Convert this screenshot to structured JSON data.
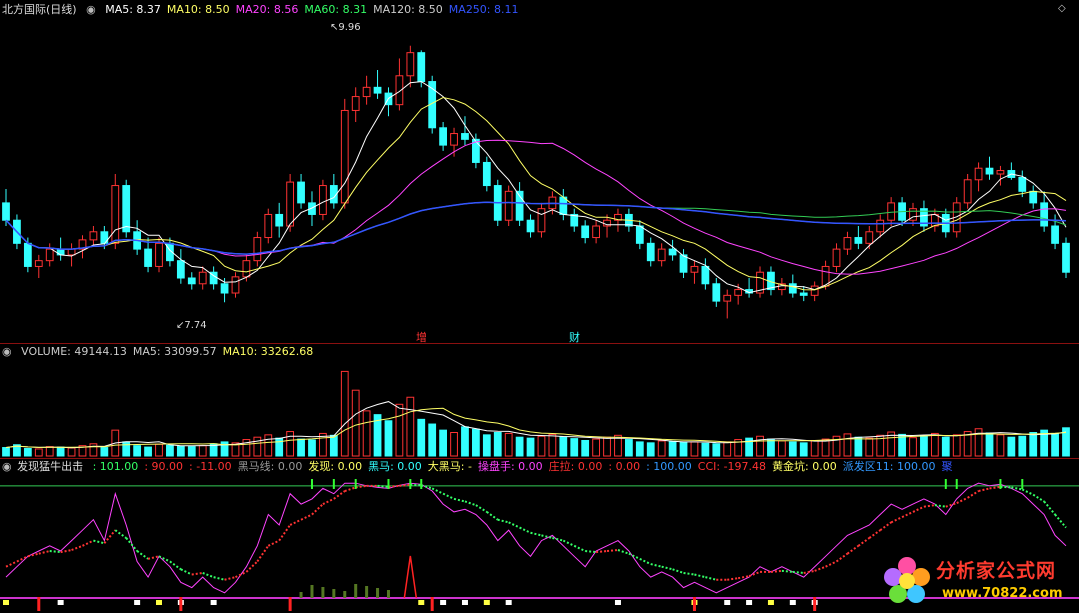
{
  "price_header": {
    "title": "北方国际(日线)",
    "items": [
      {
        "label": "MA5: 8.37",
        "color": "#ffffff"
      },
      {
        "label": "MA10: 8.50",
        "color": "#ffff66"
      },
      {
        "label": "MA20: 8.56",
        "color": "#ff44ff"
      },
      {
        "label": "MA60: 8.31",
        "color": "#33ff66"
      },
      {
        "label": "MA120: 8.50",
        "color": "#cccccc"
      },
      {
        "label": "MA250: 8.11",
        "color": "#3355ff"
      }
    ]
  },
  "volume_header": {
    "items": [
      {
        "label": "VOLUME: 49144.13",
        "color": "#cccccc"
      },
      {
        "label": "MA5: 33099.57",
        "color": "#cccccc"
      },
      {
        "label": "MA10: 33262.68",
        "color": "#ffff66"
      }
    ]
  },
  "indicator_header": {
    "title": "发现猛牛出击",
    "items": [
      {
        "label": ": 101.00",
        "color": "#33ff66"
      },
      {
        "label": ": 90.00",
        "color": "#ff3333"
      },
      {
        "label": ": -11.00",
        "color": "#ff3333"
      },
      {
        "label": "黑马线: 0.00",
        "color": "#999999"
      },
      {
        "label": "发现: 0.00",
        "color": "#ffff66"
      },
      {
        "label": "黑马: 0.00",
        "color": "#33ffff"
      },
      {
        "label": "大黑马: -",
        "color": "#ffff66"
      },
      {
        "label": "操盘手: 0.00",
        "color": "#ff44ff"
      },
      {
        "label": "庄拉: 0.00",
        "color": "#ff3333"
      },
      {
        "label": ": 0.00",
        "color": "#ff3333"
      },
      {
        "label": ": 100.00",
        "color": "#3399ff"
      },
      {
        "label": "CCI: -197.48",
        "color": "#ff3333"
      },
      {
        "label": "黄金坑: 0.00",
        "color": "#ffff66"
      },
      {
        "label": "派发区11: 100.00",
        "color": "#3399ff"
      },
      {
        "label": "聚",
        "color": "#3355ff"
      }
    ]
  },
  "icons": {
    "price_toggle": "circle-toggle-icon",
    "volume_toggle": "circle-toggle-icon",
    "indicator_toggle": "circle-toggle-icon",
    "top_right": "diamond-icon"
  },
  "annotations": {
    "high_label": "9.96",
    "low_label": "7.74",
    "marker1": "增",
    "marker2": "财"
  },
  "watermark": {
    "text": "分析家公式网",
    "url": "www.70822.com"
  },
  "chart_data": [
    {
      "type": "candlestick",
      "title": "北方国际(日线)",
      "ylim": [
        7.5,
        10.2
      ],
      "up_color": "#ff3333",
      "down_color": "#33ffff",
      "ohlc": [
        [
          8.6,
          8.72,
          8.4,
          8.45
        ],
        [
          8.45,
          8.5,
          8.2,
          8.25
        ],
        [
          8.25,
          8.3,
          8.0,
          8.05
        ],
        [
          8.05,
          8.15,
          7.95,
          8.1
        ],
        [
          8.1,
          8.25,
          8.05,
          8.2
        ],
        [
          8.2,
          8.3,
          8.1,
          8.15
        ],
        [
          8.15,
          8.25,
          8.05,
          8.2
        ],
        [
          8.2,
          8.32,
          8.12,
          8.28
        ],
        [
          8.28,
          8.4,
          8.22,
          8.35
        ],
        [
          8.35,
          8.4,
          8.2,
          8.25
        ],
        [
          8.25,
          8.85,
          8.2,
          8.75
        ],
        [
          8.75,
          8.8,
          8.3,
          8.35
        ],
        [
          8.35,
          8.45,
          8.15,
          8.2
        ],
        [
          8.2,
          8.3,
          8.0,
          8.05
        ],
        [
          8.05,
          8.3,
          8.0,
          8.25
        ],
        [
          8.25,
          8.3,
          8.05,
          8.1
        ],
        [
          8.1,
          8.2,
          7.9,
          7.95
        ],
        [
          7.95,
          8.0,
          7.85,
          7.9
        ],
        [
          7.9,
          8.05,
          7.85,
          8.0
        ],
        [
          8.0,
          8.05,
          7.85,
          7.9
        ],
        [
          7.9,
          7.95,
          7.74,
          7.82
        ],
        [
          7.82,
          8.0,
          7.78,
          7.96
        ],
        [
          7.96,
          8.15,
          7.92,
          8.1
        ],
        [
          8.1,
          8.35,
          8.05,
          8.3
        ],
        [
          8.3,
          8.55,
          8.25,
          8.5
        ],
        [
          8.5,
          8.6,
          8.3,
          8.4
        ],
        [
          8.4,
          8.85,
          8.35,
          8.78
        ],
        [
          8.78,
          8.85,
          8.55,
          8.6
        ],
        [
          8.6,
          8.7,
          8.4,
          8.5
        ],
        [
          8.5,
          8.8,
          8.45,
          8.75
        ],
        [
          8.75,
          8.85,
          8.55,
          8.6
        ],
        [
          8.6,
          9.5,
          8.55,
          9.4
        ],
        [
          9.4,
          9.6,
          9.3,
          9.52
        ],
        [
          9.52,
          9.7,
          9.45,
          9.6
        ],
        [
          9.6,
          9.75,
          9.5,
          9.55
        ],
        [
          9.55,
          9.6,
          9.35,
          9.45
        ],
        [
          9.45,
          9.85,
          9.4,
          9.7
        ],
        [
          9.7,
          9.96,
          9.6,
          9.9
        ],
        [
          9.9,
          9.92,
          9.6,
          9.65
        ],
        [
          9.65,
          9.7,
          9.2,
          9.25
        ],
        [
          9.25,
          9.3,
          9.05,
          9.1
        ],
        [
          9.1,
          9.25,
          9.0,
          9.2
        ],
        [
          9.2,
          9.35,
          9.1,
          9.15
        ],
        [
          9.15,
          9.2,
          8.9,
          8.95
        ],
        [
          8.95,
          9.0,
          8.7,
          8.75
        ],
        [
          8.75,
          8.8,
          8.4,
          8.45
        ],
        [
          8.45,
          8.75,
          8.4,
          8.7
        ],
        [
          8.7,
          8.78,
          8.4,
          8.45
        ],
        [
          8.45,
          8.5,
          8.3,
          8.35
        ],
        [
          8.35,
          8.6,
          8.3,
          8.55
        ],
        [
          8.55,
          8.7,
          8.5,
          8.65
        ],
        [
          8.65,
          8.72,
          8.45,
          8.5
        ],
        [
          8.5,
          8.55,
          8.35,
          8.4
        ],
        [
          8.4,
          8.45,
          8.25,
          8.3
        ],
        [
          8.3,
          8.45,
          8.25,
          8.4
        ],
        [
          8.4,
          8.5,
          8.3,
          8.45
        ],
        [
          8.45,
          8.55,
          8.35,
          8.5
        ],
        [
          8.5,
          8.55,
          8.35,
          8.4
        ],
        [
          8.4,
          8.45,
          8.2,
          8.25
        ],
        [
          8.25,
          8.3,
          8.05,
          8.1
        ],
        [
          8.1,
          8.25,
          8.05,
          8.2
        ],
        [
          8.2,
          8.28,
          8.1,
          8.15
        ],
        [
          8.15,
          8.2,
          7.95,
          8.0
        ],
        [
          8.0,
          8.1,
          7.9,
          8.05
        ],
        [
          8.05,
          8.12,
          7.85,
          7.9
        ],
        [
          7.9,
          7.95,
          7.7,
          7.75
        ],
        [
          7.75,
          7.85,
          7.6,
          7.8
        ],
        [
          7.8,
          7.9,
          7.72,
          7.85
        ],
        [
          7.85,
          7.95,
          7.78,
          7.82
        ],
        [
          7.82,
          8.05,
          7.78,
          8.0
        ],
        [
          8.0,
          8.05,
          7.8,
          7.85
        ],
        [
          7.85,
          7.95,
          7.8,
          7.9
        ],
        [
          7.9,
          7.98,
          7.78,
          7.82
        ],
        [
          7.82,
          7.88,
          7.75,
          7.8
        ],
        [
          7.8,
          7.92,
          7.75,
          7.88
        ],
        [
          7.88,
          8.1,
          7.85,
          8.05
        ],
        [
          8.05,
          8.25,
          8.0,
          8.2
        ],
        [
          8.2,
          8.35,
          8.15,
          8.3
        ],
        [
          8.3,
          8.4,
          8.2,
          8.25
        ],
        [
          8.25,
          8.4,
          8.2,
          8.35
        ],
        [
          8.35,
          8.5,
          8.3,
          8.45
        ],
        [
          8.45,
          8.65,
          8.4,
          8.6
        ],
        [
          8.6,
          8.65,
          8.4,
          8.45
        ],
        [
          8.45,
          8.6,
          8.4,
          8.55
        ],
        [
          8.55,
          8.62,
          8.35,
          8.4
        ],
        [
          8.4,
          8.55,
          8.35,
          8.5
        ],
        [
          8.5,
          8.55,
          8.3,
          8.35
        ],
        [
          8.35,
          8.65,
          8.3,
          8.6
        ],
        [
          8.6,
          8.85,
          8.55,
          8.8
        ],
        [
          8.8,
          8.95,
          8.7,
          8.9
        ],
        [
          8.9,
          9.0,
          8.8,
          8.85
        ],
        [
          8.85,
          8.92,
          8.75,
          8.88
        ],
        [
          8.88,
          8.95,
          8.8,
          8.82
        ],
        [
          8.82,
          8.88,
          8.65,
          8.7
        ],
        [
          8.7,
          8.75,
          8.55,
          8.6
        ],
        [
          8.6,
          8.7,
          8.35,
          8.4
        ],
        [
          8.4,
          8.5,
          8.2,
          8.25
        ],
        [
          8.25,
          8.3,
          7.95,
          8.0
        ]
      ]
    },
    {
      "type": "bar",
      "title": "VOLUME",
      "values": [
        18,
        24,
        16,
        15,
        20,
        19,
        17,
        22,
        26,
        18,
        55,
        30,
        22,
        19,
        25,
        23,
        21,
        20,
        22,
        26,
        30,
        28,
        35,
        40,
        45,
        38,
        52,
        36,
        34,
        48,
        44,
        180,
        140,
        96,
        88,
        75,
        110,
        125,
        78,
        68,
        55,
        50,
        62,
        57,
        45,
        50,
        48,
        40,
        38,
        42,
        46,
        41,
        37,
        33,
        36,
        40,
        44,
        35,
        30,
        28,
        32,
        31,
        29,
        30,
        27,
        26,
        30,
        35,
        38,
        42,
        36,
        32,
        30,
        28,
        33,
        36,
        42,
        47,
        40,
        38,
        44,
        51,
        46,
        39,
        43,
        48,
        40,
        45,
        52,
        58,
        49,
        45,
        40,
        42,
        50,
        55,
        48,
        60
      ],
      "ylim": [
        0,
        200
      ]
    },
    {
      "type": "line",
      "title": "发现猛牛出击",
      "series": [
        {
          "name": "CCI",
          "values": [
            -80,
            -60,
            -40,
            -30,
            -20,
            -30,
            -10,
            10,
            30,
            -10,
            80,
            20,
            -50,
            -80,
            -40,
            -60,
            -90,
            -100,
            -80,
            -100,
            -110,
            -90,
            -60,
            -20,
            40,
            20,
            80,
            60,
            70,
            90,
            80,
            100,
            100,
            95,
            92,
            90,
            96,
            100,
            98,
            85,
            60,
            45,
            50,
            40,
            20,
            -10,
            10,
            -20,
            -40,
            -10,
            0,
            -20,
            -40,
            -60,
            -30,
            -20,
            -10,
            -30,
            -60,
            -80,
            -70,
            -80,
            -100,
            -90,
            -100,
            -110,
            -100,
            -90,
            -80,
            -60,
            -70,
            -60,
            -70,
            -80,
            -60,
            -40,
            -20,
            0,
            10,
            20,
            40,
            60,
            50,
            60,
            70,
            60,
            40,
            70,
            90,
            100,
            95,
            98,
            90,
            80,
            60,
            40,
            0,
            -20
          ]
        },
        {
          "name": "操盘手",
          "values": [
            -60,
            -50,
            -40,
            -35,
            -30,
            -32,
            -28,
            -20,
            -10,
            -15,
            10,
            -5,
            -30,
            -45,
            -40,
            -50,
            -65,
            -75,
            -72,
            -80,
            -85,
            -80,
            -70,
            -50,
            -20,
            -10,
            20,
            30,
            40,
            60,
            70,
            85,
            92,
            95,
            95,
            93,
            95,
            97,
            96,
            90,
            80,
            70,
            65,
            58,
            45,
            30,
            25,
            15,
            5,
            0,
            -5,
            -10,
            -20,
            -30,
            -32,
            -30,
            -28,
            -35,
            -45,
            -55,
            -60,
            -65,
            -72,
            -75,
            -80,
            -85,
            -85,
            -82,
            -78,
            -70,
            -70,
            -68,
            -70,
            -72,
            -68,
            -60,
            -50,
            -35,
            -20,
            -5,
            10,
            25,
            35,
            45,
            55,
            58,
            55,
            62,
            72,
            85,
            90,
            93,
            92,
            88,
            78,
            65,
            40,
            15
          ]
        }
      ],
      "ylim": [
        -120,
        110
      ]
    }
  ]
}
